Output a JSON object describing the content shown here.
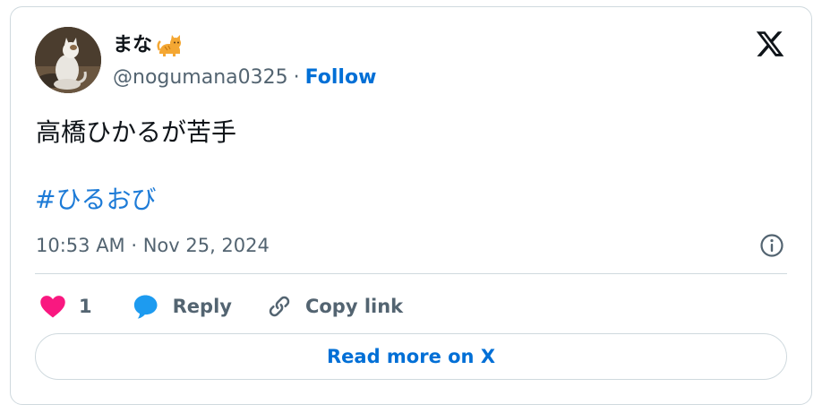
{
  "author": {
    "display_name": "まな",
    "name_emoji": "cat-emoji",
    "handle": "@nogumana0325",
    "separator": "·",
    "follow_label": "Follow"
  },
  "tweet": {
    "text": "高橋ひかるが苦手",
    "hashtag": "#ひるおび",
    "timestamp": "10:53 AM · Nov 25, 2024"
  },
  "actions": {
    "like_count": "1",
    "reply_label": "Reply",
    "copy_link_label": "Copy link"
  },
  "footer": {
    "read_more_label": "Read more on X"
  },
  "icons": {
    "brand": "x-logo-icon",
    "info": "info-icon",
    "like": "heart-icon",
    "reply": "speech-bubble-icon",
    "copy": "link-icon"
  },
  "colors": {
    "like": "#f91880",
    "reply": "#1d9bf0",
    "link": "#006fd6",
    "muted": "#536471",
    "border": "#cfd9de"
  }
}
